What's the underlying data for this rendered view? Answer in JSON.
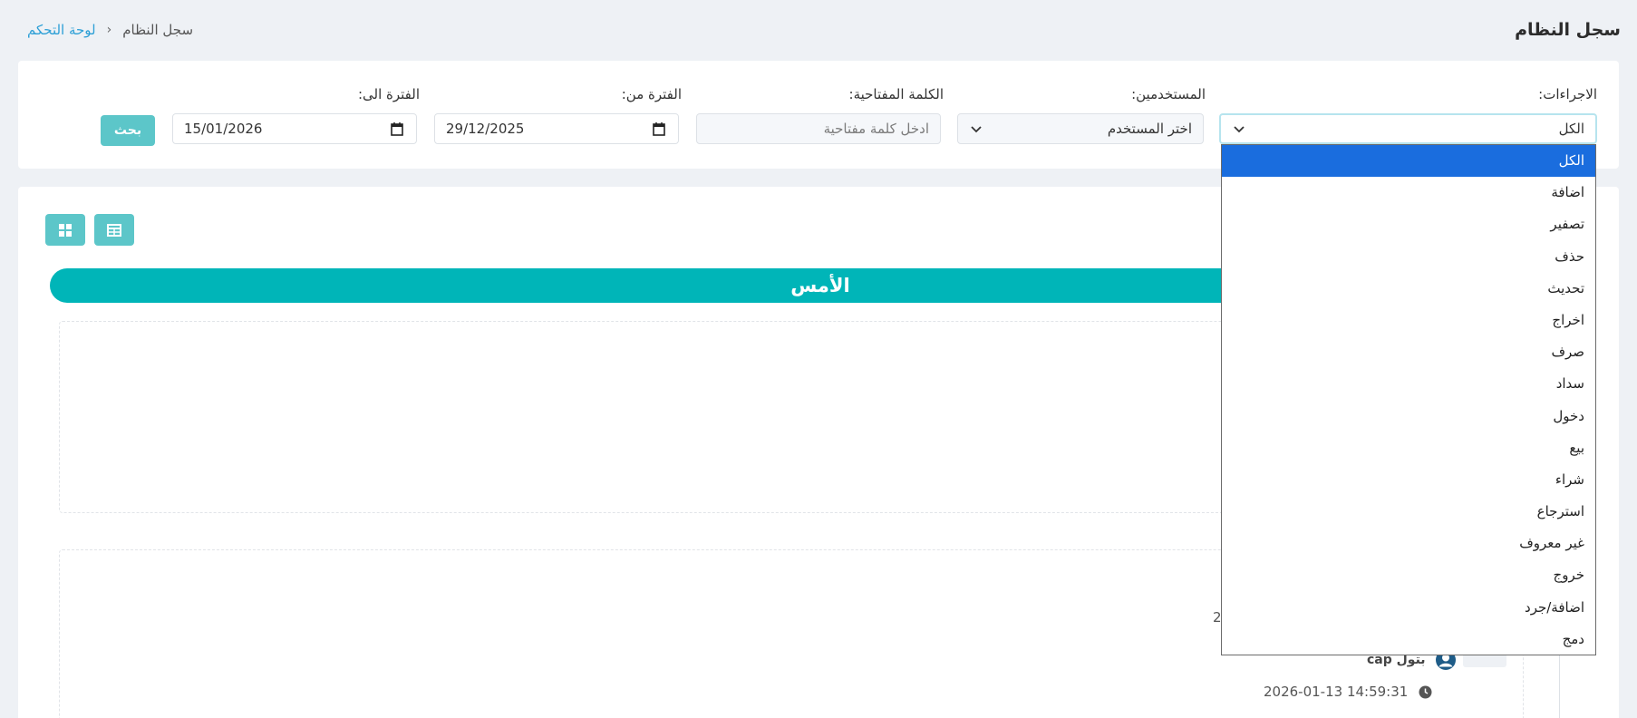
{
  "header": {
    "title": "سجل النظام",
    "breadcrumb": {
      "link": "لوحة التحكم",
      "separator": "›",
      "current": "سجل النظام"
    }
  },
  "filters": {
    "actions": {
      "label": "الاجراءات:",
      "value": "الكل"
    },
    "users": {
      "label": "المستخدمين:",
      "value": "اختر المستخدم"
    },
    "keyword": {
      "label": "الكلمة المفتاحية:",
      "placeholder": "ادخل كلمة مفتاحية"
    },
    "date_from": {
      "label": "الفترة من:",
      "value": "29/12/2025"
    },
    "date_to": {
      "label": "الفترة الى:",
      "value": "15/01/2026"
    },
    "search_label": "بحث"
  },
  "main": {
    "day_label": "الأمس",
    "stray_text": "2",
    "entry": {
      "user": "بتول cap",
      "timestamp": "2026-01-13 14:59:31"
    }
  },
  "dropdown": {
    "options": [
      "الكل",
      "اضافة",
      "تصفير",
      "حذف",
      "تحديث",
      "اخراج",
      "صرف",
      "سداد",
      "دخول",
      "بيع",
      "شراء",
      "استرجاع",
      "غير معروف",
      "خروج",
      "اضافة/جرد",
      "دمج"
    ],
    "selected": "الكل"
  },
  "colors": {
    "accent": "#00b5b8",
    "button": "#5cc6c9",
    "link": "#2c9fd6",
    "selected": "#1a6dde"
  },
  "icons": {
    "grid_view": "grid-view-icon",
    "table_view": "table-view-icon",
    "user": "user-icon",
    "clock": "clock-icon",
    "calendar": "calendar-icon",
    "chevron": "chevron-down-icon"
  }
}
